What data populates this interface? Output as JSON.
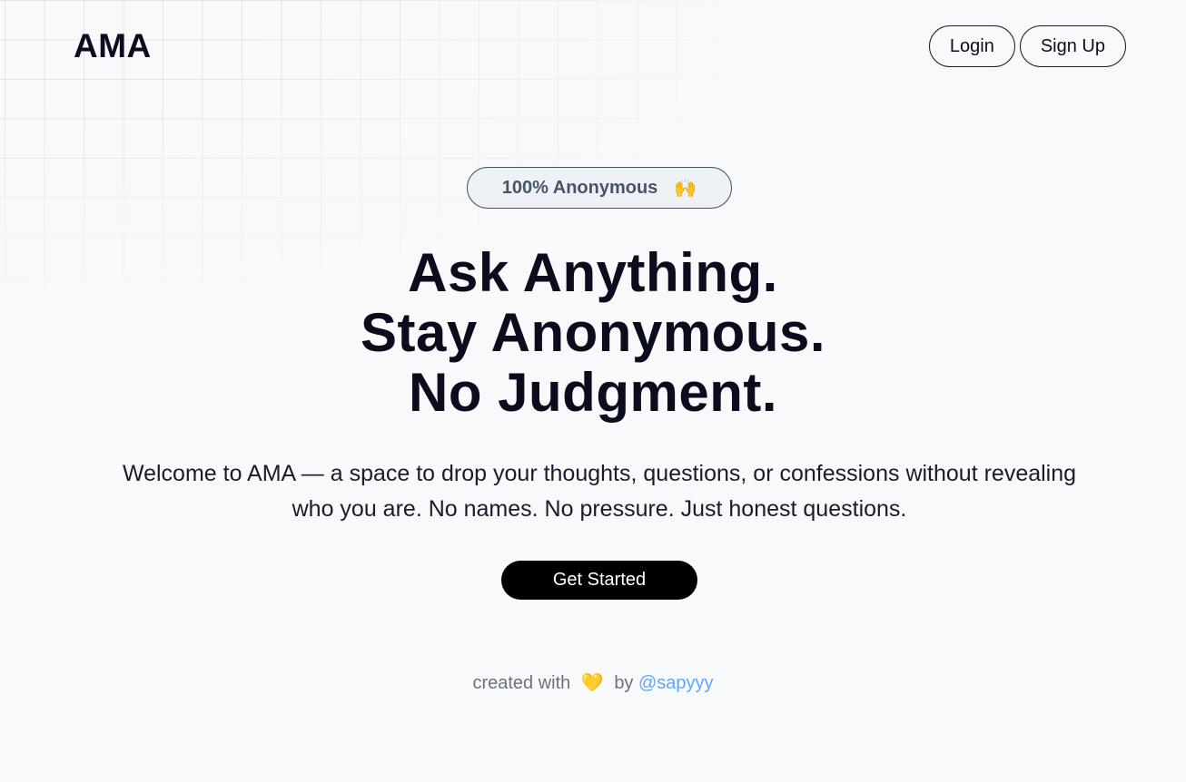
{
  "header": {
    "logo": "AMA",
    "login_label": "Login",
    "signup_label": "Sign Up"
  },
  "hero": {
    "badge_text": "100% Anonymous",
    "badge_icon": "raising-hands-icon",
    "headline": [
      "Ask Anything.",
      "Stay Anonymous.",
      "No Judgment."
    ],
    "intro": "Welcome to AMA — a space to drop your thoughts, questions, or confessions without revealing who you are. No names. No pressure. Just honest questions.",
    "cta_label": "Get Started"
  },
  "footer": {
    "prefix": "created with",
    "heart_icon": "yellow-heart-icon",
    "by": "by",
    "author": "@sapyyy"
  },
  "colors": {
    "background": "#f8f9fb",
    "text": "#0b0d1f",
    "badge_text": "#475569",
    "cta_bg": "#000000",
    "link": "#60a5fa",
    "heart": "#f4a020"
  }
}
